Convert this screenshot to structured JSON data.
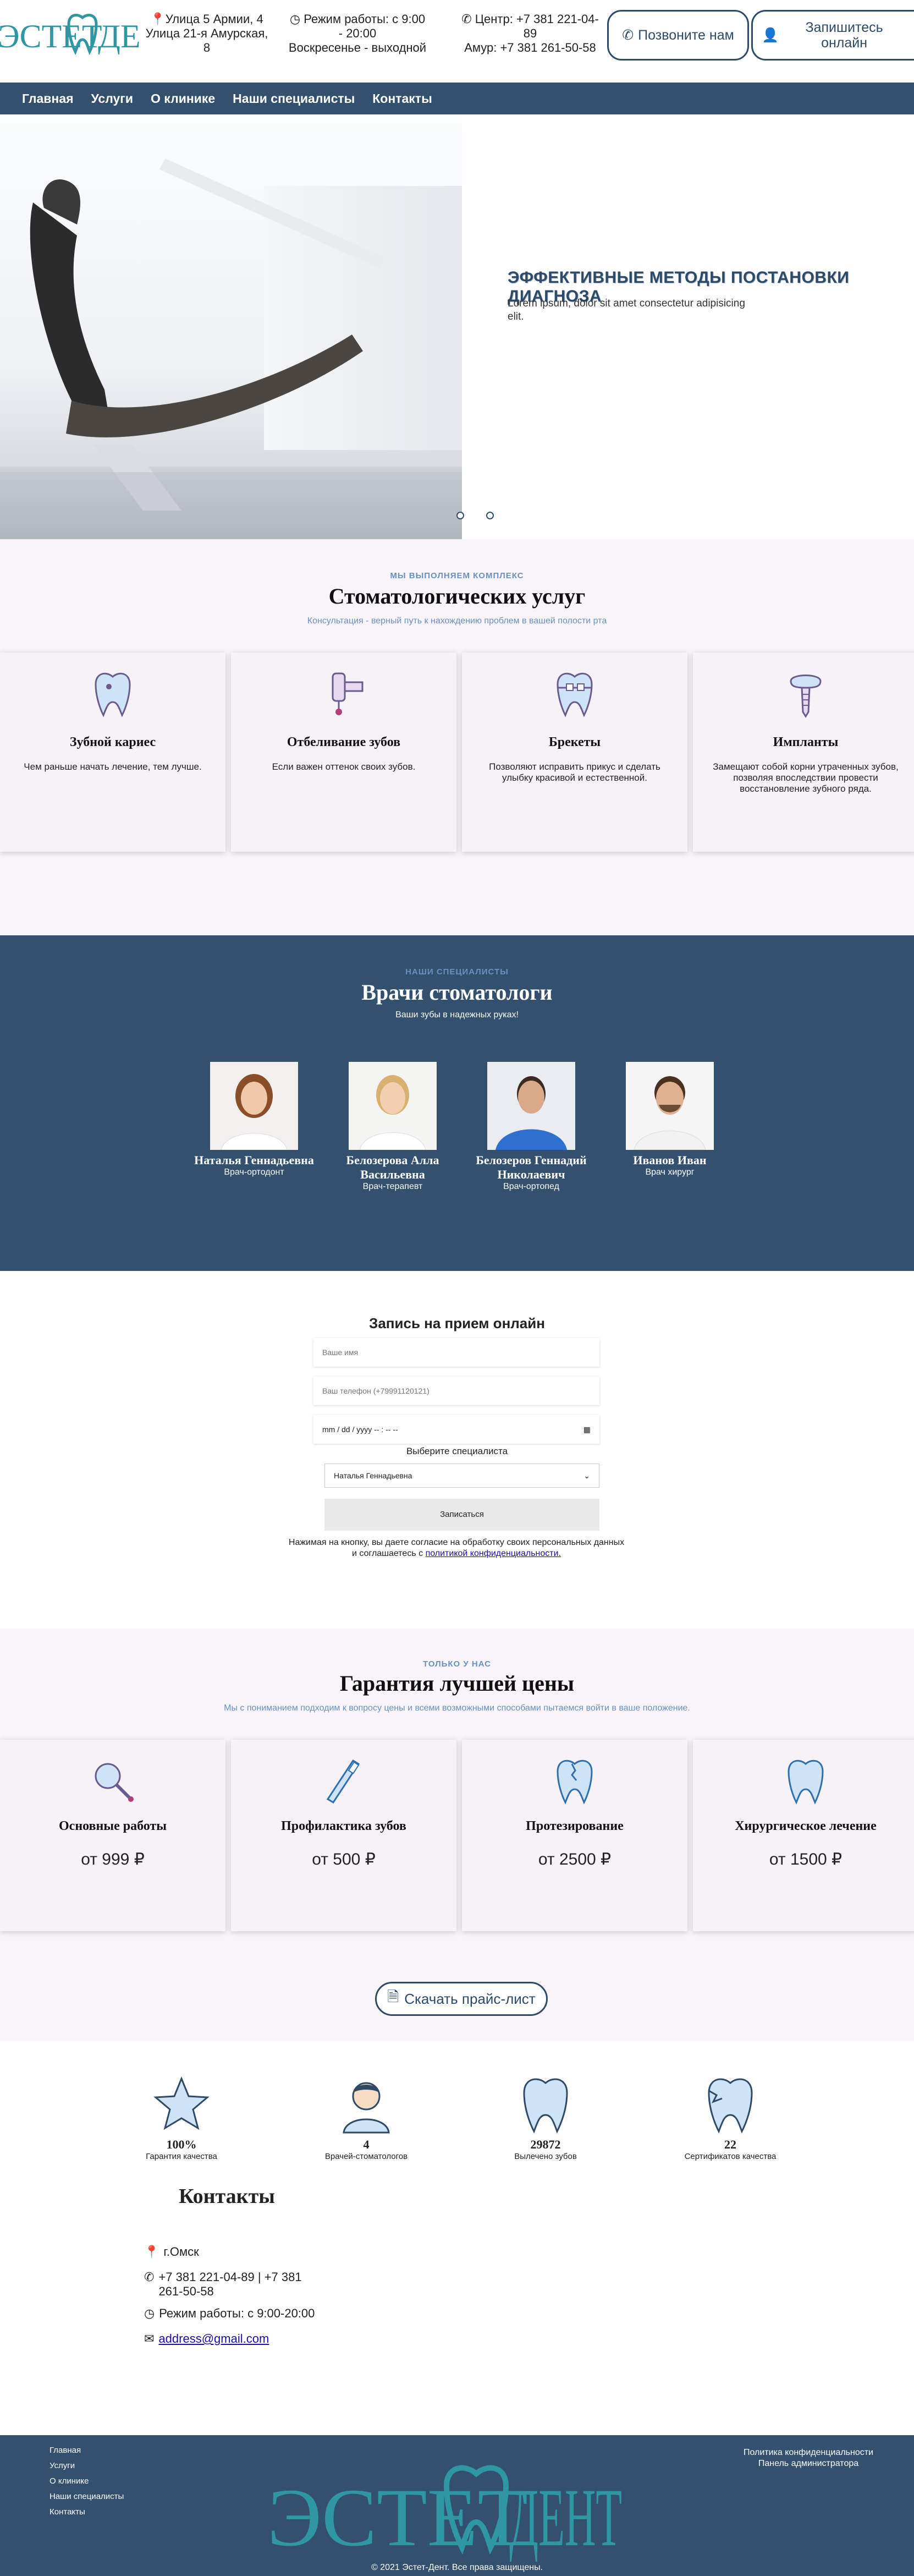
{
  "header": {
    "address_line1": "Улица 5 Армии, 4",
    "address_line2": "Улица 21-я Амурская, 8",
    "hours_line1": "Режим работы: с 9:00 - 20:00",
    "hours_line2": "Воскресенье - выходной",
    "phone_center": "Центр: +7 381 221-04-89",
    "phone_amur": "Амур: +7 381 261-50-58",
    "call_button": "Позвоните нам",
    "book_button": "Запишитесь онлайн",
    "logo_text": "ЭСТЕТ ДЕНТ",
    "logo_parts": [
      "ЭСТЕТ",
      "ДЕНТ"
    ]
  },
  "nav": [
    "Главная",
    "Услуги",
    "О клинике",
    "Наши специалисты",
    "Контакты"
  ],
  "hero": {
    "title": "ЭФФЕКТИВНЫЕ МЕТОДЫ ПОСТАНОВКИ ДИАГНОЗА",
    "text": "Lorem ipsum, dolor sit amet consectetur adipisicing elit."
  },
  "services": {
    "kicker": "МЫ ВЫПОЛНЯЕМ КОМПЛЕКС",
    "title": "Стоматологических услуг",
    "subtitle": "Консультация - верный путь к нахождению проблем в вашей полости рта",
    "items": [
      {
        "title": "Зубной кариес",
        "desc": "Чем раньше начать лечение, тем лучше.",
        "icon": "tooth-icon"
      },
      {
        "title": "Отбеливание зубов",
        "desc": "Если важен оттенок своих зубов.",
        "icon": "whitening-icon"
      },
      {
        "title": "Брекеты",
        "desc": "Позволяют исправить прикус и сделать улыбку красивой и естественной.",
        "icon": "braces-icon"
      },
      {
        "title": "Импланты",
        "desc": "Замещают собой корни утраченных зубов, позволяя впоследствии провести восстановление зубного ряда.",
        "icon": "implant-icon"
      }
    ]
  },
  "doctors": {
    "kicker": "НАШИ СПЕЦИАЛИСТЫ",
    "title": "Врачи стоматологи",
    "subtitle": "Ваши зубы в надежных руках!",
    "items": [
      {
        "name": "Наталья Геннадьевна",
        "role": "Врач-ортодонт"
      },
      {
        "name": "Белозерова Алла Васильевна",
        "role": "Врач-терапевт"
      },
      {
        "name": "Белозеров Геннадий Николаевич",
        "role": "Врач-ортопед"
      },
      {
        "name": "Иванов Иван",
        "role": "Врач хирург"
      }
    ]
  },
  "booking": {
    "title": "Запись на прием онлайн",
    "name_placeholder": "Ваше имя",
    "phone_placeholder": "Ваш телефон (+79991120121)",
    "date_value": "mm / dd / yyyy -- : -- --",
    "specialist_label": "Выберите специалиста",
    "specialist_selected": "Наталья Геннадьевна",
    "submit": "Записаться",
    "consent_text": "Нажимая на кнопку, вы даете согласие на обработку своих персональных данных и соглашаетесь с",
    "consent_link": "политикой конфиденциальности."
  },
  "prices": {
    "kicker": "ТОЛЬКО У НАС",
    "title": "Гарантия лучшей цены",
    "subtitle": "Мы с пониманием подходим к вопросу цены и всеми возможными способами пытаемся войти в ваше положение.",
    "items": [
      {
        "title": "Основные работы",
        "price": "от 999 ₽",
        "icon": "magnifier-icon"
      },
      {
        "title": "Профилактика зубов",
        "price": "от 500 ₽",
        "icon": "toothbrush-icon"
      },
      {
        "title": "Протезирование",
        "price": "от 2500 ₽",
        "icon": "cracked-tooth-icon"
      },
      {
        "title": "Хирургическое лечение",
        "price": "от 1500 ₽",
        "icon": "tooth-icon"
      }
    ],
    "download_button": "Скачать прайс-лист"
  },
  "stats": [
    {
      "value": "100%",
      "label": "Гарантия качества",
      "icon": "star-icon"
    },
    {
      "value": "4",
      "label": "Врачей-стоматологов",
      "icon": "doctor-icon"
    },
    {
      "value": "29872",
      "label": "Вылечено зубов",
      "icon": "tooth-icon"
    },
    {
      "value": "22",
      "label": "Сертификатов качества",
      "icon": "broken-tooth-icon"
    }
  ],
  "contacts": {
    "title": "Контакты",
    "city": "г.Омск",
    "phones": "+7 381 221-04-89 | +7 381 261-50-58",
    "hours": "Режим работы: с 9:00-20:00",
    "email": "address@gmail.com"
  },
  "footer": {
    "links": [
      "Главная",
      "Услуги",
      "О клинике",
      "Наши специалисты",
      "Контакты"
    ],
    "privacy": "Политика конфиденциальности",
    "admin": "Панель администратора",
    "copyright": "© 2021 Эстет-Дент. Все права защищены."
  },
  "colors": {
    "brand": "#34506f",
    "accent": "#6a8fc0",
    "tooth": "#2e97a3"
  }
}
